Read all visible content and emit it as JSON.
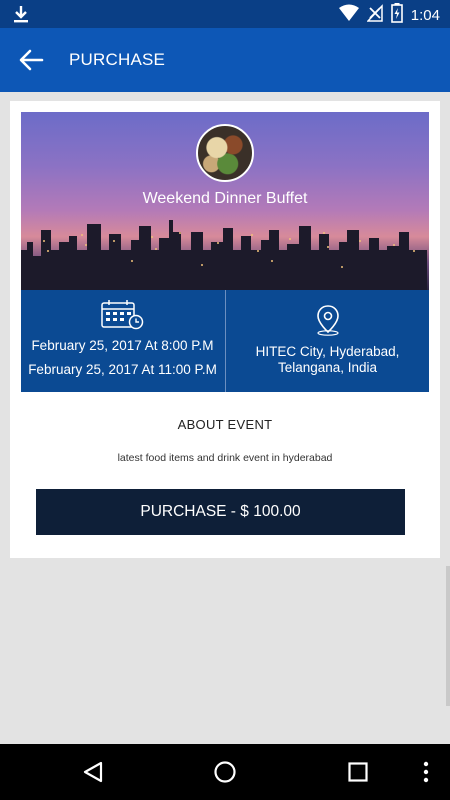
{
  "status_bar": {
    "time": "1:04",
    "icons": [
      "download-icon",
      "wifi-icon",
      "no-signal-icon",
      "battery-icon"
    ]
  },
  "app_bar": {
    "title": "PURCHASE",
    "back_icon": "arrow-left-icon"
  },
  "event": {
    "title": "Weekend Dinner Buffet",
    "start": "February 25, 2017 At 8:00 P.M",
    "end": "February 25, 2017 At 11:00 P.M",
    "location": "HITEC City, Hyderabad, Telangana, India",
    "about_heading": "ABOUT EVENT",
    "description": "latest food items and drink event in hyderabad"
  },
  "purchase_button": "PURCHASE - $ 100.00",
  "colors": {
    "status_bar": "#0a3f86",
    "app_bar": "#0d57b6",
    "info_panel": "#0b4a93",
    "button": "#0e1f38"
  },
  "nav_bar": {
    "icons": [
      "back-triangle-icon",
      "home-circle-icon",
      "recents-square-icon",
      "more-vert-icon"
    ]
  }
}
